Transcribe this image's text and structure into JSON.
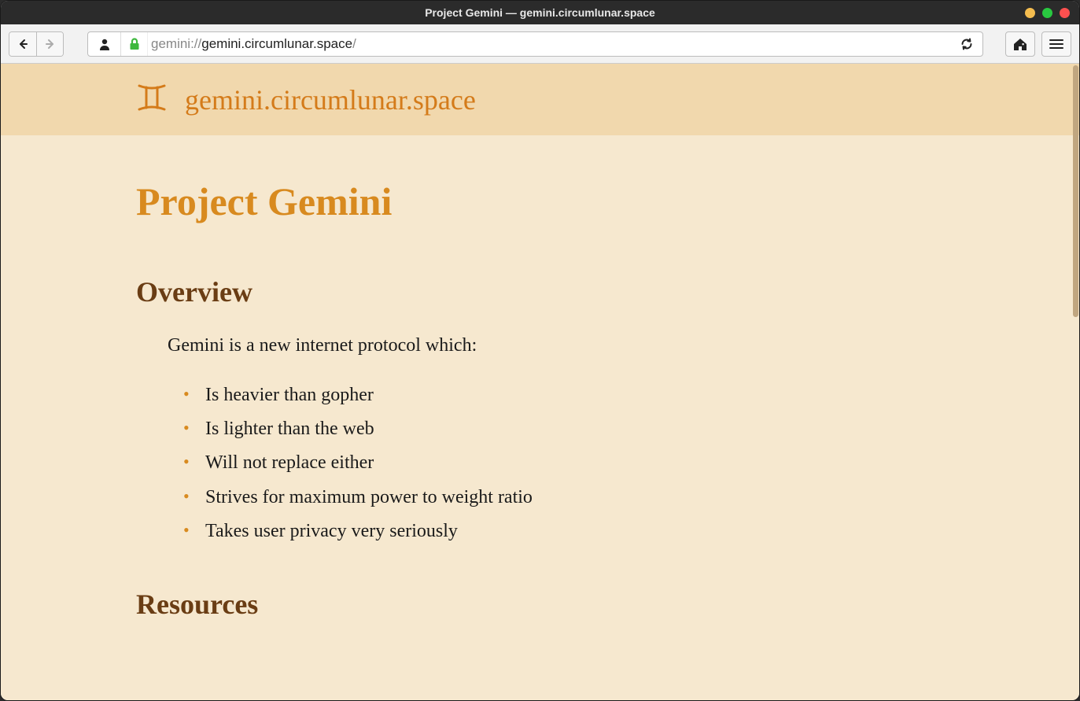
{
  "window": {
    "title": "Project Gemini — gemini.circumlunar.space"
  },
  "toolbar": {
    "url_scheme": "gemini://",
    "url_host": "gemini.circumlunar.space",
    "url_path": "/"
  },
  "header": {
    "site_title": "gemini.circumlunar.space"
  },
  "page": {
    "h1": "Project Gemini",
    "overview_heading": "Overview",
    "intro": "Gemini is a new internet protocol which:",
    "bullets": [
      "Is heavier than gopher",
      "Is lighter than the web",
      "Will not replace either",
      "Strives for maximum power to weight ratio",
      "Takes user privacy very seriously"
    ],
    "resources_heading": "Resources"
  }
}
